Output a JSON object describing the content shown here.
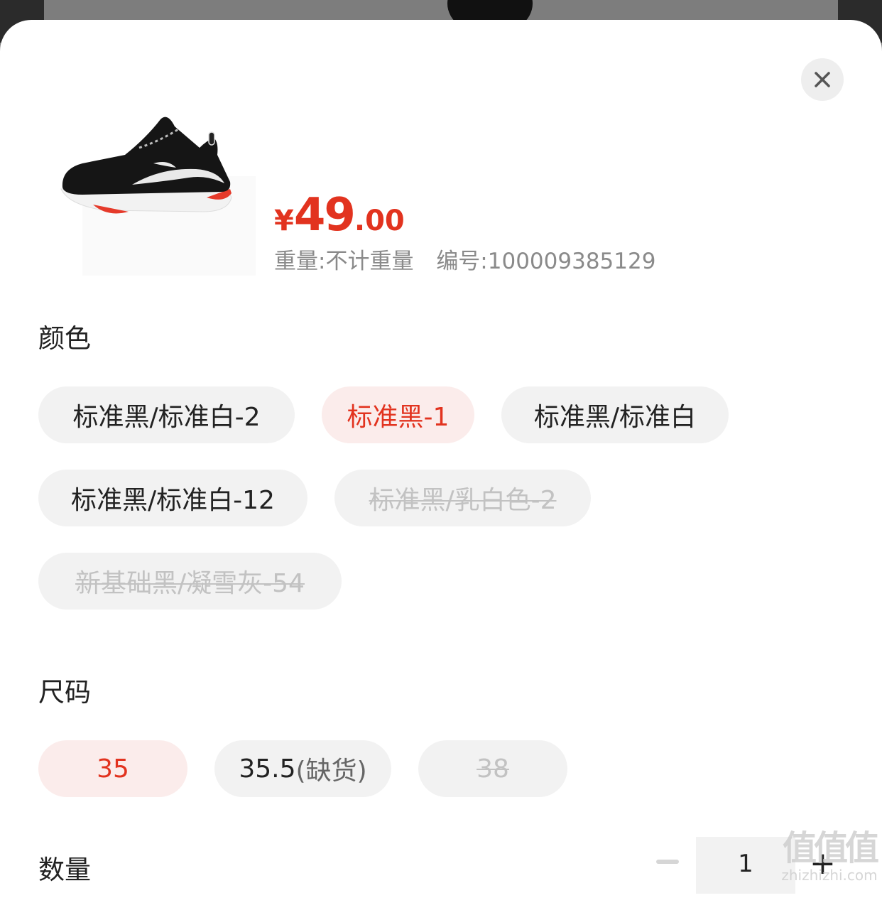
{
  "colors": {
    "accent": "#e2331f",
    "chip_bg": "#f2f2f2",
    "chip_selected_bg": "#fbeceb",
    "disabled_text": "#c2c2c2"
  },
  "product": {
    "image_icon": "sneaker-image",
    "price": {
      "currency": "¥",
      "integer": "49",
      "decimal": ".00"
    },
    "weight": "重量:不计重量",
    "sku": "编号:100009385129"
  },
  "color_section": {
    "title": "颜色",
    "options": [
      {
        "label": "标准黑/标准白-2",
        "state": "normal"
      },
      {
        "label": "标准黑-1",
        "state": "selected"
      },
      {
        "label": "标准黑/标准白",
        "state": "normal"
      },
      {
        "label": "标准黑/标准白-12",
        "state": "normal"
      },
      {
        "label": "标准黑/乳白色-2",
        "state": "disabled"
      },
      {
        "label": "新基础黑/凝雪灰-54",
        "state": "disabled"
      }
    ]
  },
  "size_section": {
    "title": "尺码",
    "options": [
      {
        "label": "35",
        "state": "selected"
      },
      {
        "label": "35.5",
        "sub": "(缺货)",
        "state": "normal"
      },
      {
        "label": "38",
        "state": "disabled"
      }
    ]
  },
  "quantity": {
    "title": "数量",
    "value": "1",
    "minus_icon": "minus-icon",
    "plus_icon": "plus-icon"
  },
  "close_icon": "close-icon",
  "watermark": {
    "logo": "值值值",
    "url": "zhizhizhi.com"
  }
}
